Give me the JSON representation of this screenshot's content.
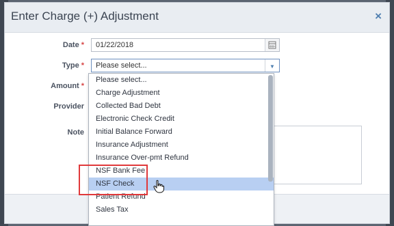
{
  "dialog": {
    "title": "Enter Charge (+) Adjustment",
    "close_label": "×"
  },
  "form": {
    "date": {
      "label": "Date",
      "required": "*",
      "value": "01/22/2018"
    },
    "type": {
      "label": "Type",
      "required": "*",
      "value": "Please select..."
    },
    "amount": {
      "label": "Amount",
      "required": "*"
    },
    "provider": {
      "label": "Provider"
    },
    "note": {
      "label": "Note"
    }
  },
  "type_options": [
    "Please select...",
    "Charge Adjustment",
    "Collected Bad Debt",
    "Electronic Check Credit",
    "Initial Balance Forward",
    "Insurance Adjustment",
    "Insurance Over-pmt Refund",
    "NSF Bank Fee",
    "NSF Check",
    "Patient Refund",
    "Sales Tax"
  ],
  "highlighted_option": "NSF Check",
  "colors": {
    "accent": "#4f7fb0",
    "selected_row": "#b8cff2",
    "annotation": "#e0383a"
  },
  "icons": {
    "calendar": "calendar-icon",
    "dropdown": "chevron-down-icon",
    "cursor": "hand-pointer-icon"
  }
}
